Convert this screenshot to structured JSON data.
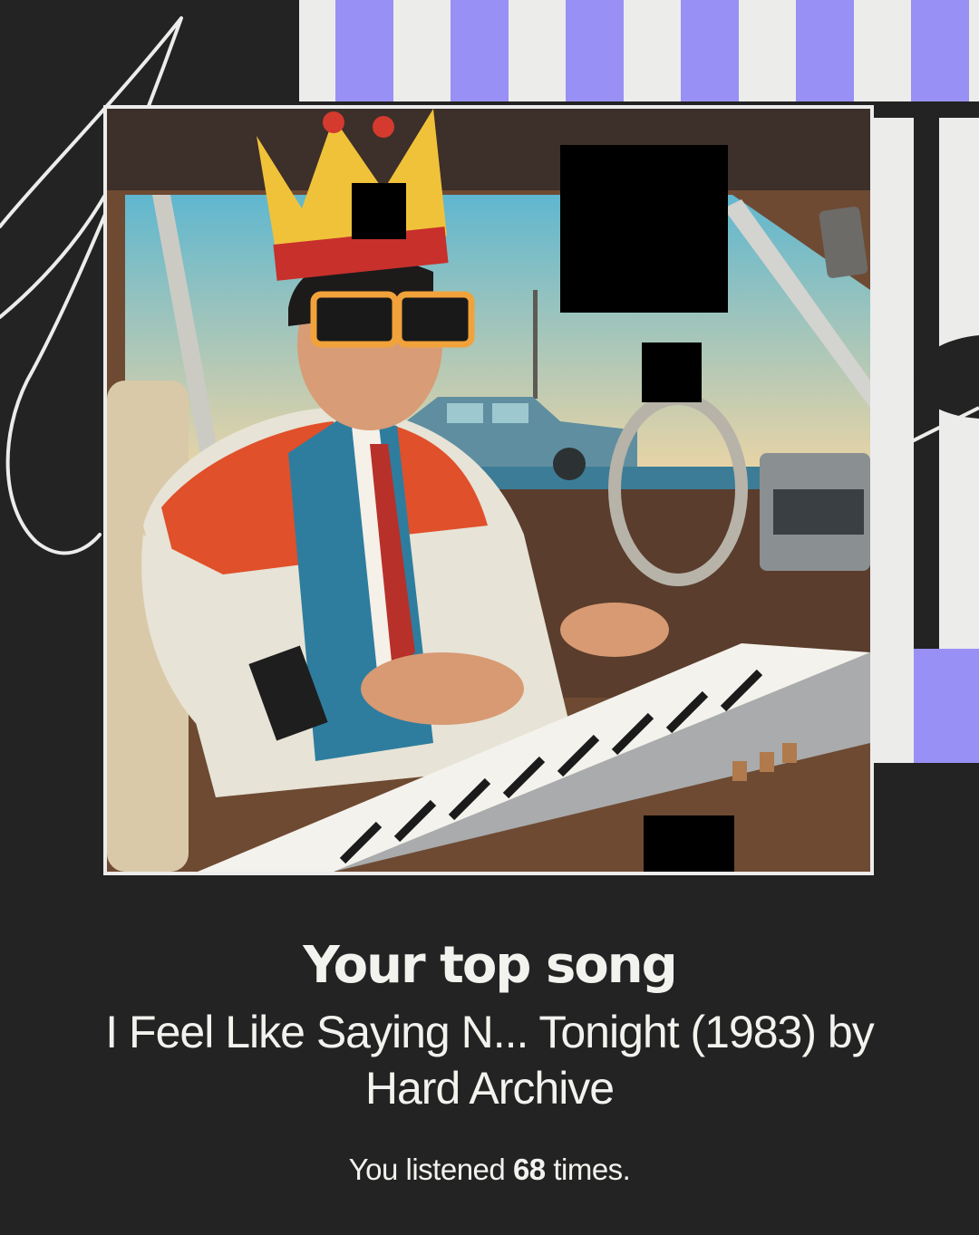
{
  "story": {
    "heading": "Your top song",
    "song_line": "I Feel Like Saying N... Tonight (1983) by Hard Archive",
    "listens_prefix": "You listened ",
    "listens_count": "68",
    "listens_suffix": " times."
  },
  "artwork": {
    "icon": "album-artwork-image"
  },
  "colors": {
    "background": "#232323",
    "stripe_accent": "#9990f5",
    "stripe_light": "#ececea",
    "text": "#f2f2ee"
  }
}
